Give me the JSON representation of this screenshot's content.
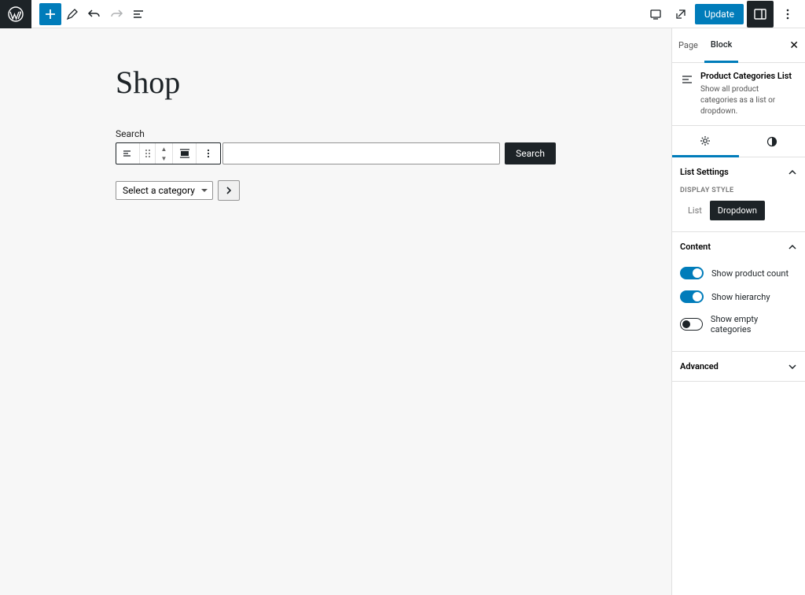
{
  "header": {
    "update_label": "Update"
  },
  "editor": {
    "page_title": "Shop",
    "search_label": "Search",
    "search_button": "Search",
    "category_placeholder": "Select a category"
  },
  "sidebar": {
    "tabs": {
      "page": "Page",
      "block": "Block"
    },
    "block_info": {
      "title": "Product Categories List",
      "description": "Show all product categories as a list or dropdown."
    },
    "list_settings": {
      "title": "List Settings",
      "display_style_label": "Display Style",
      "options": {
        "list": "List",
        "dropdown": "Dropdown"
      }
    },
    "content": {
      "title": "Content",
      "show_product_count": "Show product count",
      "show_hierarchy": "Show hierarchy",
      "show_empty": "Show empty categories"
    },
    "advanced": {
      "title": "Advanced"
    }
  }
}
